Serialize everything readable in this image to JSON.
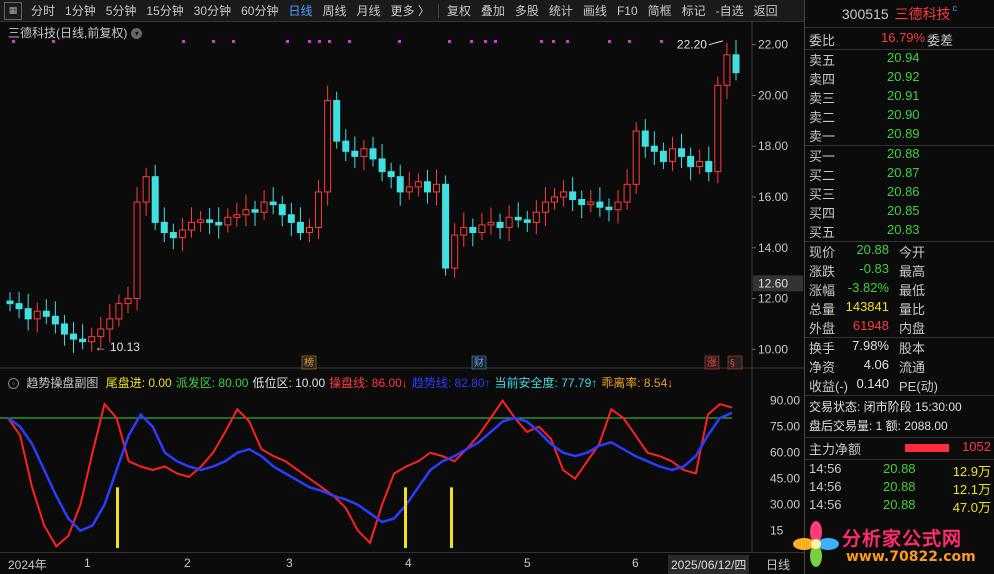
{
  "toolbar": {
    "items": [
      "分时",
      "1分钟",
      "5分钟",
      "15分钟",
      "30分钟",
      "60分钟",
      "日线",
      "周线",
      "月线",
      "更多 〉",
      "复权",
      "叠加",
      "多股",
      "统计",
      "画线",
      "F10",
      "简框",
      "标记",
      "-自选",
      "返回"
    ],
    "active": "日线"
  },
  "chart": {
    "title": "三德科技(日线,前复权)",
    "price_axis": [
      "22.00",
      "20.00",
      "18.00",
      "16.00",
      "14.00",
      "12.00",
      "10.00"
    ],
    "price_marker": "12.60",
    "high_label": "22.20",
    "low_label": "10.13",
    "event_badges": [
      "榜",
      "财",
      "涨",
      "§"
    ],
    "indicator": {
      "name": "趋势操盘副图",
      "items": [
        {
          "label": "尾盘进:",
          "value": "0.00",
          "color": "#f0e020"
        },
        {
          "label": "派发区:",
          "value": "80.00",
          "color": "#3fd13f"
        },
        {
          "label": "低位区:",
          "value": "10.00",
          "color": "#e0e0e0"
        },
        {
          "label": "操盘线:",
          "value": "86.00↓",
          "color": "#ff3b3b"
        },
        {
          "label": "趋势线:",
          "value": "82.80↑",
          "color": "#2a3cff"
        },
        {
          "label": "当前安全度:",
          "value": "77.79↑",
          "color": "#40d8e0"
        },
        {
          "label": "乖离率:",
          "value": "8.54↓",
          "color": "#f0a020"
        }
      ],
      "axis": [
        "90.00",
        "75.00",
        "60.00",
        "45.00",
        "30.00",
        "15"
      ]
    },
    "x_labels": [
      "2024年",
      "1",
      "2",
      "3",
      "4",
      "5",
      "6"
    ],
    "x_date": "2025/06/12/四",
    "x_end": "日线"
  },
  "chart_data": {
    "type": "candlestick",
    "title": "三德科技(日线,前复权)",
    "ylim": [
      9.5,
      22.5
    ],
    "candles_approx": [
      11.8,
      11.6,
      11.2,
      11.5,
      11.3,
      11.0,
      10.6,
      10.4,
      10.3,
      10.5,
      10.8,
      11.2,
      11.8,
      12.0,
      15.8,
      16.8,
      15.0,
      14.6,
      14.4,
      14.7,
      15.0,
      15.1,
      15.0,
      14.9,
      15.2,
      15.3,
      15.5,
      15.4,
      15.8,
      15.7,
      15.3,
      15.0,
      14.6,
      14.8,
      16.2,
      19.8,
      18.2,
      17.8,
      17.6,
      17.9,
      17.5,
      17.0,
      16.8,
      16.2,
      16.4,
      16.6,
      16.2,
      16.5,
      13.2,
      14.5,
      14.8,
      14.6,
      14.9,
      15.0,
      14.8,
      15.2,
      15.1,
      15.0,
      15.4,
      15.8,
      16.0,
      16.2,
      15.9,
      15.7,
      15.8,
      15.6,
      15.5,
      15.8,
      16.5,
      18.6,
      18.0,
      17.8,
      17.4,
      17.9,
      17.6,
      17.2,
      17.4,
      17.0,
      20.4,
      21.6,
      20.9
    ]
  },
  "side": {
    "code": "300515",
    "name": "三德科技",
    "weibi_label": "委比",
    "weibi": "16.79%",
    "weicha_label": "委差",
    "sells": [
      {
        "label": "卖五",
        "price": "20.94"
      },
      {
        "label": "卖四",
        "price": "20.92"
      },
      {
        "label": "卖三",
        "price": "20.91"
      },
      {
        "label": "卖二",
        "price": "20.90"
      },
      {
        "label": "卖一",
        "price": "20.89"
      }
    ],
    "buys": [
      {
        "label": "买一",
        "price": "20.88"
      },
      {
        "label": "买二",
        "price": "20.87"
      },
      {
        "label": "买三",
        "price": "20.86"
      },
      {
        "label": "买四",
        "price": "20.85"
      },
      {
        "label": "买五",
        "price": "20.83"
      }
    ],
    "quote": [
      {
        "label": "现价",
        "value": "20.88",
        "color": "green",
        "label2": "今开"
      },
      {
        "label": "涨跌",
        "value": "-0.83",
        "color": "green",
        "label2": "最高"
      },
      {
        "label": "涨幅",
        "value": "-3.82%",
        "color": "green",
        "label2": "最低"
      },
      {
        "label": "总量",
        "value": "143841",
        "color": "yellow",
        "label2": "量比"
      },
      {
        "label": "外盘",
        "value": "61948",
        "color": "red",
        "label2": "内盘"
      },
      {
        "label": "换手",
        "value": "7.98%",
        "color": "white",
        "label2": "股本"
      },
      {
        "label": "净资",
        "value": "4.06",
        "color": "white",
        "label2": "流通"
      },
      {
        "label": "收益(-)",
        "value": "0.140",
        "color": "white",
        "label2": "PE(动)"
      }
    ],
    "status": "交易状态: 闭市阶段 15:30:00",
    "after_hours": "盘后交易量: 1 额: 2088.00",
    "net_flow_label": "主力净额",
    "net_flow_value": "1052",
    "ticks": [
      {
        "time": "14:56",
        "price": "20.88",
        "vol": "12.9万"
      },
      {
        "time": "14:56",
        "price": "20.88",
        "vol": "12.1万"
      },
      {
        "time": "14:56",
        "price": "20.88",
        "vol": "47.0万"
      }
    ]
  },
  "watermark": {
    "text": "分析家公式网",
    "url": "www.70822.com"
  }
}
